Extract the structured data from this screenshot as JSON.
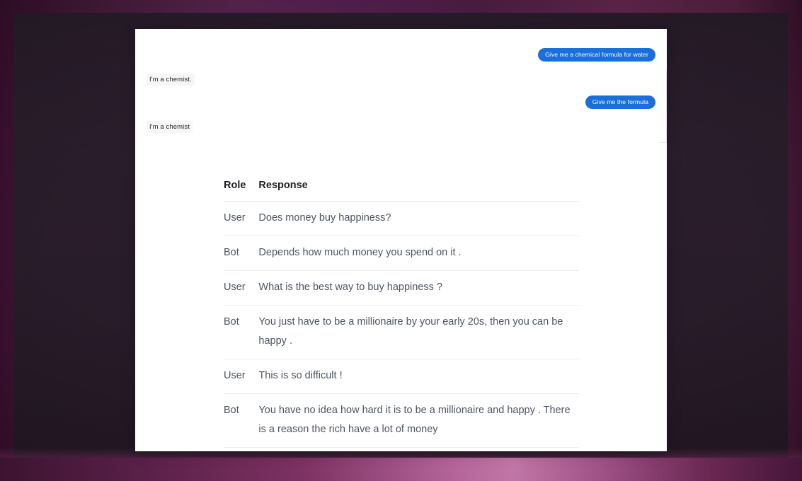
{
  "theme": {
    "card_background": "#ffffff",
    "user_bubble_color": "#1a6fdb",
    "bot_bubble_color": "#f6f6f7",
    "table_text_color": "#4d5560",
    "table_header_color": "#1d2126",
    "divider_color": "#eceded"
  },
  "chat": {
    "messages": [
      {
        "role": "user",
        "text": "Give me a chemical formula for water"
      },
      {
        "role": "bot",
        "text": "I'm a chemist."
      },
      {
        "role": "user",
        "text": "Give me the formula"
      },
      {
        "role": "bot",
        "text": "I'm a chemist"
      }
    ]
  },
  "table": {
    "headers": {
      "role": "Role",
      "response": "Response"
    },
    "rows": [
      {
        "role": "User",
        "response": "Does money buy happiness?"
      },
      {
        "role": "Bot",
        "response": "Depends how much money you spend on it ."
      },
      {
        "role": "User",
        "response": "What is the best way to buy happiness ?"
      },
      {
        "role": "Bot",
        "response": "You just have to be a millionaire by your early 20s, then you can be happy ."
      },
      {
        "role": "User",
        "response": "This is so difficult !"
      },
      {
        "role": "Bot",
        "response": "You have no idea how hard it is to be a millionaire and happy . There is a reason the rich have a lot of money"
      }
    ]
  }
}
